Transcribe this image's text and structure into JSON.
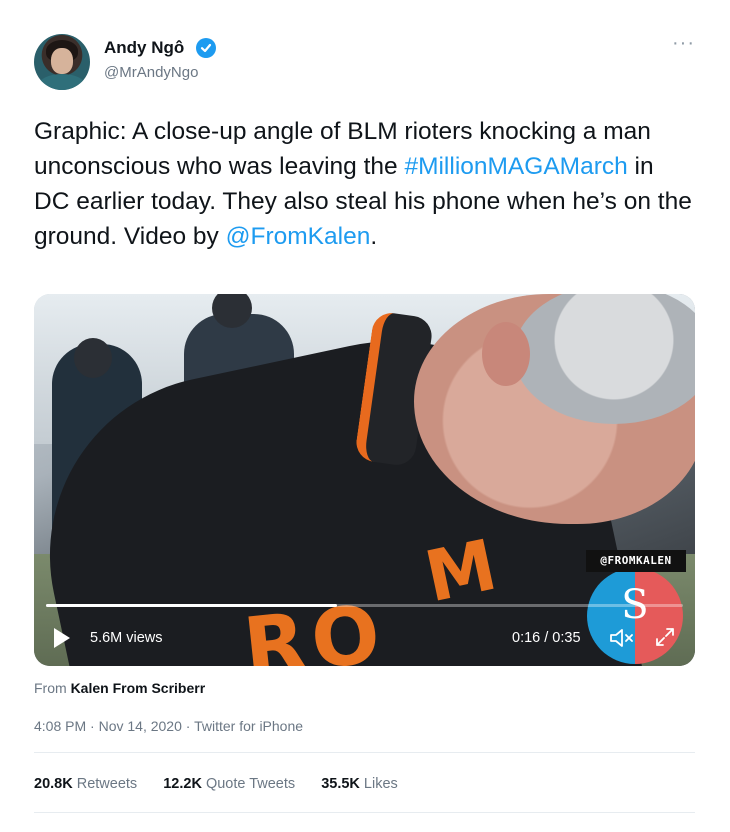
{
  "author": {
    "name": "Andy Ngô",
    "handle": "@MrAndyNgo",
    "verified": true
  },
  "tweet": {
    "text_part1": "Graphic: A close-up angle of BLM rioters knocking a man unconscious who was leaving the ",
    "hashtag": "#MillionMAGAMarch",
    "text_part2": " in DC earlier today. They also steal his phone when he’s on the ground. Video by ",
    "mention": "@FromKalen",
    "text_part3": "."
  },
  "video": {
    "views": "5.6M views",
    "time": "0:16 / 0:35",
    "watermark": "@FROMKALEN",
    "logo_letter": "S",
    "jacket_letters_top": "M",
    "jacket_letters_bottom": "RO",
    "progress": 0.457
  },
  "source": {
    "prefix": "From ",
    "name": "Kalen From Scriberr"
  },
  "meta": {
    "time": "4:08 PM",
    "date": "Nov 14, 2020",
    "client": "Twitter for iPhone",
    "sep": " · "
  },
  "stats": {
    "retweets_count": "20.8K",
    "retweets_label": "Retweets",
    "quotes_count": "12.2K",
    "quotes_label": "Quote Tweets",
    "likes_count": "35.5K",
    "likes_label": "Likes"
  },
  "colors": {
    "link": "#1d9bf0",
    "accent_orange": "#e8721f"
  },
  "icons": {
    "verified": "verified-badge-icon",
    "more": "more-options-icon",
    "play": "play-icon",
    "mute": "mute-icon",
    "expand": "expand-icon"
  }
}
